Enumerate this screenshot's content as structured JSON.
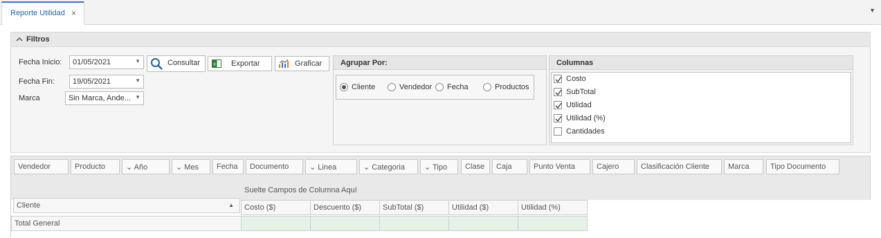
{
  "tab": {
    "label": "Reporte Utilidad",
    "close": "×"
  },
  "filtros": {
    "title": "Filtros",
    "fecha_inicio": {
      "label": "Fecha Inicio:",
      "value": "01/05/2021"
    },
    "fecha_fin": {
      "label": "Fecha Fin:",
      "value": "19/05/2021"
    },
    "marca": {
      "label": "Marca",
      "value": "Sin Marca, Ande..."
    },
    "buttons": {
      "consultar": "Consultar",
      "exportar": "Exportar",
      "graficar": "Graficar"
    }
  },
  "agrupar": {
    "title": "Agrupar Por:",
    "options": [
      "Cliente",
      "Vendedor",
      "Fecha",
      "Productos"
    ],
    "selected": "Cliente"
  },
  "columnas": {
    "title": "Columnas",
    "items": [
      {
        "label": "Costo",
        "checked": true
      },
      {
        "label": "SubTotal",
        "checked": true
      },
      {
        "label": "Utilidad",
        "checked": true
      },
      {
        "label": "Utilidad (%)",
        "checked": true
      },
      {
        "label": "Cantidades",
        "checked": false
      }
    ]
  },
  "pivot": {
    "fields": [
      "Vendedor",
      "Producto",
      "Año",
      "Mes",
      "Fecha",
      "Documento",
      "Linea",
      "Categoria",
      "Tipo",
      "Clase",
      "Caja",
      "Punto Venta",
      "Cajero",
      "Clasificación Cliente",
      "Marca",
      "Tipo Documento"
    ],
    "drop_hint": "Suelte Campos de Columna Aquí",
    "row_header": "Cliente",
    "columns": [
      "Costo ($)",
      "Descuento ($)",
      "SubTotal ($)",
      "Utilidad ($)",
      "Utilidad (%)"
    ],
    "total_label": "Total General"
  },
  "colors": {
    "accent": "#2b78d0",
    "total_row": "#e6f2e6"
  }
}
